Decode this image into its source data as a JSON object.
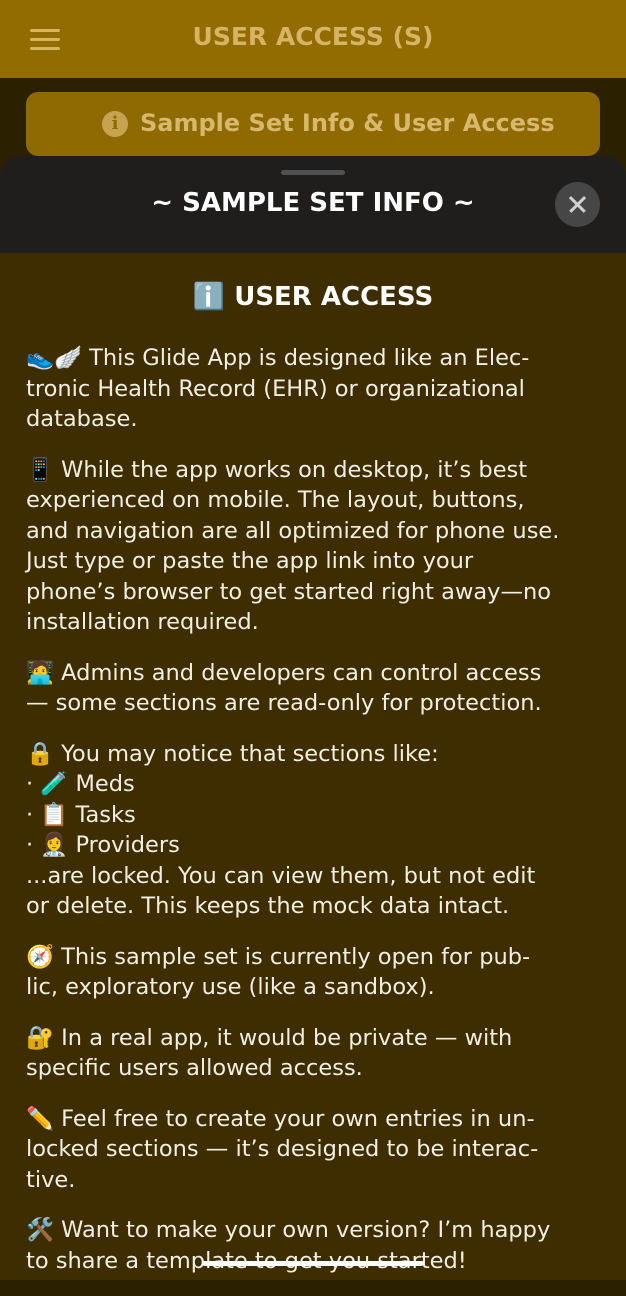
{
  "header": {
    "title": "USER ACCESS (S)"
  },
  "info_button": {
    "label": "Sample Set Info & User Access"
  },
  "sheet": {
    "title": "~ SAMPLE SET INFO ~",
    "heading": "ℹ️ USER ACCESS",
    "paragraphs": [
      {
        "lines": [
          "👟🪽 This Glide App is designed like an Elec-",
          "tronic Health Record (EHR) or organizational",
          "database."
        ]
      },
      {
        "lines": [
          "📱 While the app works on desktop, it’s best",
          "experienced on mobile. The layout, buttons,",
          "and navigation are all optimized for phone use.",
          "Just type or paste the app link into your",
          "phone’s browser to get started right away—no",
          "installation required."
        ]
      },
      {
        "lines": [
          "🧑‍💻 Admins and developers can control access",
          "— some sections are read-only for protection."
        ]
      },
      {
        "lines": [
          "🔒 You may notice that sections like:",
          "·  🧪 Meds",
          "·  📋 Tasks",
          "·  👩‍⚕️ Providers",
          "...are locked. You can view them, but not edit",
          "or delete. This keeps the mock data intact."
        ]
      },
      {
        "lines": [
          "🧭 This sample set is currently open for pub-",
          "lic, exploratory use (like a sandbox)."
        ]
      },
      {
        "lines": [
          "🔐 In a real app, it would be private — with",
          "specific users allowed access."
        ]
      },
      {
        "lines": [
          "✏️ Feel free to create your own entries in un-",
          "locked sections — it’s designed to be interac-",
          "tive."
        ]
      },
      {
        "lines": [
          "🛠️ Want to make your own version? I’m happy",
          "to share a template to get you started!"
        ]
      }
    ]
  },
  "icons": {
    "menu": "hamburger-menu-icon",
    "info": "info-circle-icon",
    "close": "close-icon"
  },
  "colors": {
    "topbar": "#926c00",
    "button": "#8e6a00",
    "sheet_bg": "#3d2d00",
    "sheet_header": "#1f1e1d"
  }
}
